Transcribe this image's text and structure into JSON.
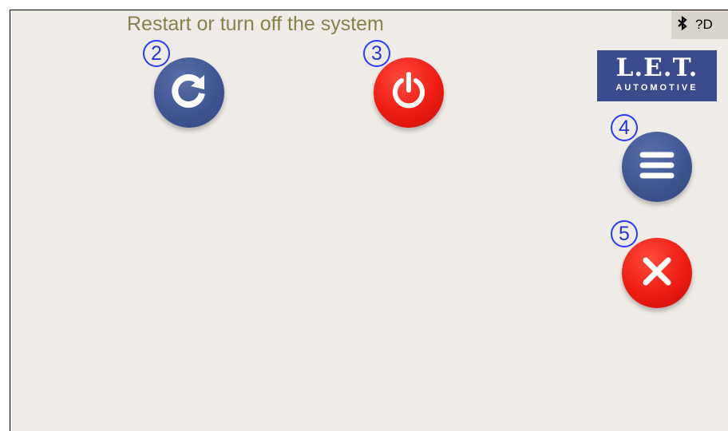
{
  "header": {
    "title": "Restart or turn off the system"
  },
  "status_bar": {
    "bluetooth_icon": "bluetooth-icon",
    "bluetooth_glyph": "✱",
    "trailing_text": "?D"
  },
  "buttons": {
    "restart": {
      "badge": "2",
      "icon": "restart-icon",
      "color": "#3f5694"
    },
    "power": {
      "badge": "3",
      "icon": "power-icon",
      "color": "#ee1c12"
    },
    "menu": {
      "badge": "4",
      "icon": "menu-icon",
      "color": "#3f5694"
    },
    "close": {
      "badge": "5",
      "icon": "close-icon",
      "color": "#ee1c12"
    }
  },
  "logo": {
    "line1": "L.E.T.",
    "line2": "AUTOMOTIVE",
    "color": "#3a4c8e"
  }
}
